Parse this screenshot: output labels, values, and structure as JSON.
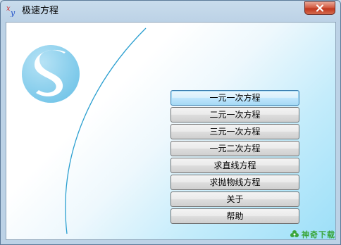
{
  "window": {
    "title": "极速方程",
    "close_glyph": "✕",
    "app_icon_text": "xy"
  },
  "buttons": [
    {
      "label": "一元一次方程"
    },
    {
      "label": "二元一次方程"
    },
    {
      "label": "三元一次方程"
    },
    {
      "label": "一元二次方程"
    },
    {
      "label": "求直线方程"
    },
    {
      "label": "求抛物线方程"
    },
    {
      "label": "关于"
    },
    {
      "label": "帮助"
    }
  ],
  "watermark": {
    "text": "神奇下载"
  },
  "colors": {
    "logo_fill": "#8fd3f0",
    "curve": "#2a9fd0",
    "close_button": "#c9452b",
    "focus_border": "#3c7fb1"
  }
}
